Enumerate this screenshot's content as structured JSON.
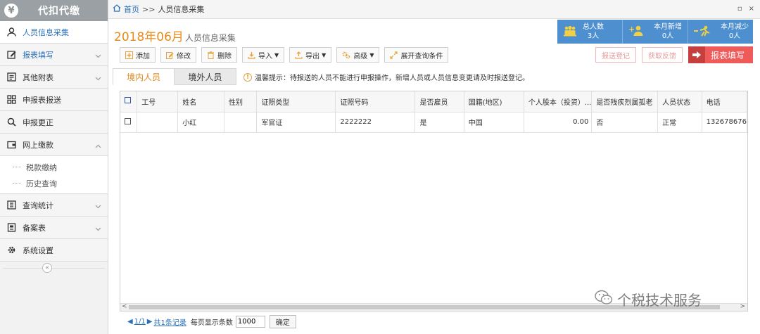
{
  "sidebar": {
    "logo_icon": "¥",
    "title": "代扣代缴",
    "items": [
      {
        "label": "人员信息采集",
        "icon": "person-icon",
        "active": true
      },
      {
        "label": "报表填写",
        "icon": "edit-icon",
        "expandable": true
      },
      {
        "label": "其他附表",
        "icon": "list-icon",
        "expandable": true
      },
      {
        "label": "申报表报送",
        "icon": "grid-icon"
      },
      {
        "label": "申报更正",
        "icon": "search-icon"
      },
      {
        "label": "网上缴款",
        "icon": "wallet-icon",
        "expandable": true,
        "expanded": true,
        "children": [
          {
            "label": "税款缴纳"
          },
          {
            "label": "历史查询"
          }
        ]
      },
      {
        "label": "查询统计",
        "icon": "report-icon",
        "expandable": true
      },
      {
        "label": "备案表",
        "icon": "file-icon",
        "expandable": true
      },
      {
        "label": "系统设置",
        "icon": "gear-icon"
      }
    ],
    "collapse_glyph": "«"
  },
  "topbar": {
    "home": "首页",
    "sep": ">>",
    "crumb": "人员信息采集",
    "win_ctrls": [
      "▫",
      "×"
    ]
  },
  "title": {
    "main": "2018年06月",
    "sub": "人员信息采集"
  },
  "stats": [
    {
      "label": "总人数",
      "value": "3人",
      "icon": "people-group-icon"
    },
    {
      "label": "本月新增",
      "value": "0人",
      "icon": "person-add-icon"
    },
    {
      "label": "本月减少",
      "value": "0人",
      "icon": "person-minus-icon"
    }
  ],
  "toolbar": {
    "add": "添加",
    "edit": "修改",
    "delete": "删除",
    "import": "导入",
    "export": "导出",
    "advanced": "高级",
    "expand_query": "展开查询条件",
    "dropdown_glyph": "▼"
  },
  "right_buttons": {
    "submit_register": "报送登记",
    "get_feedback": "获取反馈",
    "fill_report": "报表填写"
  },
  "tabs": [
    {
      "label": "境内人员",
      "active": true
    },
    {
      "label": "境外人员",
      "active": false
    }
  ],
  "tip": {
    "glyph": "!",
    "text": "温馨提示：待报送的人员不能进行申报操作，新增人员或人员信息变更请及时报送登记。"
  },
  "table": {
    "columns": [
      "工号",
      "姓名",
      "性别",
      "证照类型",
      "证照号码",
      "是否雇员",
      "国籍(地区)",
      "个人股本（投资）...",
      "是否残疾烈属孤老",
      "人员状态",
      "电话"
    ],
    "rows": [
      [
        "",
        "小红",
        "",
        "军官证",
        "2222222",
        "是",
        "中国",
        "0.00",
        "否",
        "正常",
        "132678676"
      ]
    ]
  },
  "scroll": {
    "left": "<",
    "right": ">"
  },
  "pager": {
    "pages": "1/1",
    "records": "共1条记录",
    "per_page_label": "每页显示条数",
    "per_page_value": "1000",
    "confirm": "确定"
  },
  "watermark": "个税技术服务"
}
